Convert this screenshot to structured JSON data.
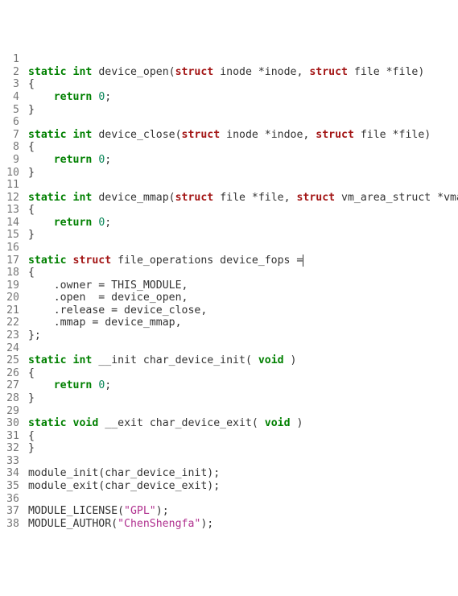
{
  "lines": [
    {
      "n": 1,
      "tokens": []
    },
    {
      "n": 2,
      "tokens": [
        {
          "c": "kw",
          "t": "static"
        },
        {
          "c": "sp",
          "t": " "
        },
        {
          "c": "kw",
          "t": "int"
        },
        {
          "c": "sp",
          "t": " "
        },
        {
          "c": "id",
          "t": "device_open("
        },
        {
          "c": "tkw",
          "t": "struct"
        },
        {
          "c": "id",
          "t": " inode *inode, "
        },
        {
          "c": "tkw",
          "t": "struct"
        },
        {
          "c": "id",
          "t": " file *file)"
        }
      ]
    },
    {
      "n": 3,
      "tokens": [
        {
          "c": "id",
          "t": "{"
        }
      ]
    },
    {
      "n": 4,
      "tokens": [
        {
          "c": "sp",
          "t": "    "
        },
        {
          "c": "ret",
          "t": "return"
        },
        {
          "c": "id",
          "t": " "
        },
        {
          "c": "num",
          "t": "0"
        },
        {
          "c": "id",
          "t": ";"
        }
      ]
    },
    {
      "n": 5,
      "tokens": [
        {
          "c": "id",
          "t": "}"
        }
      ]
    },
    {
      "n": 6,
      "tokens": []
    },
    {
      "n": 7,
      "tokens": [
        {
          "c": "kw",
          "t": "static"
        },
        {
          "c": "sp",
          "t": " "
        },
        {
          "c": "kw",
          "t": "int"
        },
        {
          "c": "sp",
          "t": " "
        },
        {
          "c": "id",
          "t": "device_close("
        },
        {
          "c": "tkw",
          "t": "struct"
        },
        {
          "c": "id",
          "t": " inode *indoe, "
        },
        {
          "c": "tkw",
          "t": "struct"
        },
        {
          "c": "id",
          "t": " file *file)"
        }
      ]
    },
    {
      "n": 8,
      "tokens": [
        {
          "c": "id",
          "t": "{"
        }
      ]
    },
    {
      "n": 9,
      "tokens": [
        {
          "c": "sp",
          "t": "    "
        },
        {
          "c": "ret",
          "t": "return"
        },
        {
          "c": "id",
          "t": " "
        },
        {
          "c": "num",
          "t": "0"
        },
        {
          "c": "id",
          "t": ";"
        }
      ]
    },
    {
      "n": 10,
      "tokens": [
        {
          "c": "id",
          "t": "}"
        }
      ]
    },
    {
      "n": 11,
      "tokens": []
    },
    {
      "n": 12,
      "tokens": [
        {
          "c": "kw",
          "t": "static"
        },
        {
          "c": "sp",
          "t": " "
        },
        {
          "c": "kw",
          "t": "int"
        },
        {
          "c": "sp",
          "t": " "
        },
        {
          "c": "id",
          "t": "device_mmap("
        },
        {
          "c": "tkw",
          "t": "struct"
        },
        {
          "c": "id",
          "t": " file *file, "
        },
        {
          "c": "tkw",
          "t": "struct"
        },
        {
          "c": "id",
          "t": " vm_area_struct *vma)"
        }
      ]
    },
    {
      "n": 13,
      "tokens": [
        {
          "c": "id",
          "t": "{"
        }
      ]
    },
    {
      "n": 14,
      "tokens": [
        {
          "c": "sp",
          "t": "    "
        },
        {
          "c": "ret",
          "t": "return"
        },
        {
          "c": "id",
          "t": " "
        },
        {
          "c": "num",
          "t": "0"
        },
        {
          "c": "id",
          "t": ";"
        }
      ]
    },
    {
      "n": 15,
      "tokens": [
        {
          "c": "id",
          "t": "}"
        }
      ]
    },
    {
      "n": 16,
      "tokens": []
    },
    {
      "n": 17,
      "tokens": [
        {
          "c": "kw",
          "t": "static"
        },
        {
          "c": "sp",
          "t": " "
        },
        {
          "c": "tkw",
          "t": "struct"
        },
        {
          "c": "id",
          "t": " file_operations device_fops ="
        },
        {
          "c": "cursor",
          "t": ""
        }
      ]
    },
    {
      "n": 18,
      "tokens": [
        {
          "c": "id",
          "t": "{"
        }
      ]
    },
    {
      "n": 19,
      "tokens": [
        {
          "c": "sp",
          "t": "    "
        },
        {
          "c": "id",
          "t": ".owner = THIS_MODULE,"
        }
      ]
    },
    {
      "n": 20,
      "tokens": [
        {
          "c": "sp",
          "t": "    "
        },
        {
          "c": "id",
          "t": ".open  = device_open,"
        }
      ]
    },
    {
      "n": 21,
      "tokens": [
        {
          "c": "sp",
          "t": "    "
        },
        {
          "c": "id",
          "t": ".release = device_close,"
        }
      ]
    },
    {
      "n": 22,
      "tokens": [
        {
          "c": "sp",
          "t": "    "
        },
        {
          "c": "id",
          "t": ".mmap = device_mmap,"
        }
      ]
    },
    {
      "n": 23,
      "tokens": [
        {
          "c": "id",
          "t": "};"
        }
      ]
    },
    {
      "n": 24,
      "tokens": []
    },
    {
      "n": 25,
      "tokens": [
        {
          "c": "kw",
          "t": "static"
        },
        {
          "c": "sp",
          "t": " "
        },
        {
          "c": "kw",
          "t": "int"
        },
        {
          "c": "sp",
          "t": " "
        },
        {
          "c": "id",
          "t": "__init char_device_init( "
        },
        {
          "c": "kw",
          "t": "void"
        },
        {
          "c": "id",
          "t": " )"
        }
      ]
    },
    {
      "n": 26,
      "tokens": [
        {
          "c": "id",
          "t": "{"
        }
      ]
    },
    {
      "n": 27,
      "tokens": [
        {
          "c": "sp",
          "t": "    "
        },
        {
          "c": "ret",
          "t": "return"
        },
        {
          "c": "id",
          "t": " "
        },
        {
          "c": "num",
          "t": "0"
        },
        {
          "c": "id",
          "t": ";"
        }
      ]
    },
    {
      "n": 28,
      "tokens": [
        {
          "c": "id",
          "t": "}"
        }
      ]
    },
    {
      "n": 29,
      "tokens": []
    },
    {
      "n": 30,
      "tokens": [
        {
          "c": "kw",
          "t": "static"
        },
        {
          "c": "sp",
          "t": " "
        },
        {
          "c": "kw",
          "t": "void"
        },
        {
          "c": "sp",
          "t": " "
        },
        {
          "c": "id",
          "t": "__exit char_device_exit( "
        },
        {
          "c": "kw",
          "t": "void"
        },
        {
          "c": "id",
          "t": " )"
        }
      ]
    },
    {
      "n": 31,
      "tokens": [
        {
          "c": "id",
          "t": "{"
        }
      ]
    },
    {
      "n": 32,
      "tokens": [
        {
          "c": "id",
          "t": "}"
        }
      ]
    },
    {
      "n": 33,
      "tokens": []
    },
    {
      "n": 34,
      "tokens": [
        {
          "c": "id",
          "t": "module_init(char_device_init);"
        }
      ]
    },
    {
      "n": 35,
      "tokens": [
        {
          "c": "id",
          "t": "module_exit(char_device_exit);"
        }
      ]
    },
    {
      "n": 36,
      "tokens": []
    },
    {
      "n": 37,
      "tokens": [
        {
          "c": "id",
          "t": "MODULE_LICENSE("
        },
        {
          "c": "str",
          "t": "\"GPL\""
        },
        {
          "c": "id",
          "t": ");"
        }
      ]
    },
    {
      "n": 38,
      "tokens": [
        {
          "c": "id",
          "t": "MODULE_AUTHOR("
        },
        {
          "c": "str",
          "t": "\"ChenShengfa\""
        },
        {
          "c": "id",
          "t": ");"
        }
      ]
    }
  ]
}
